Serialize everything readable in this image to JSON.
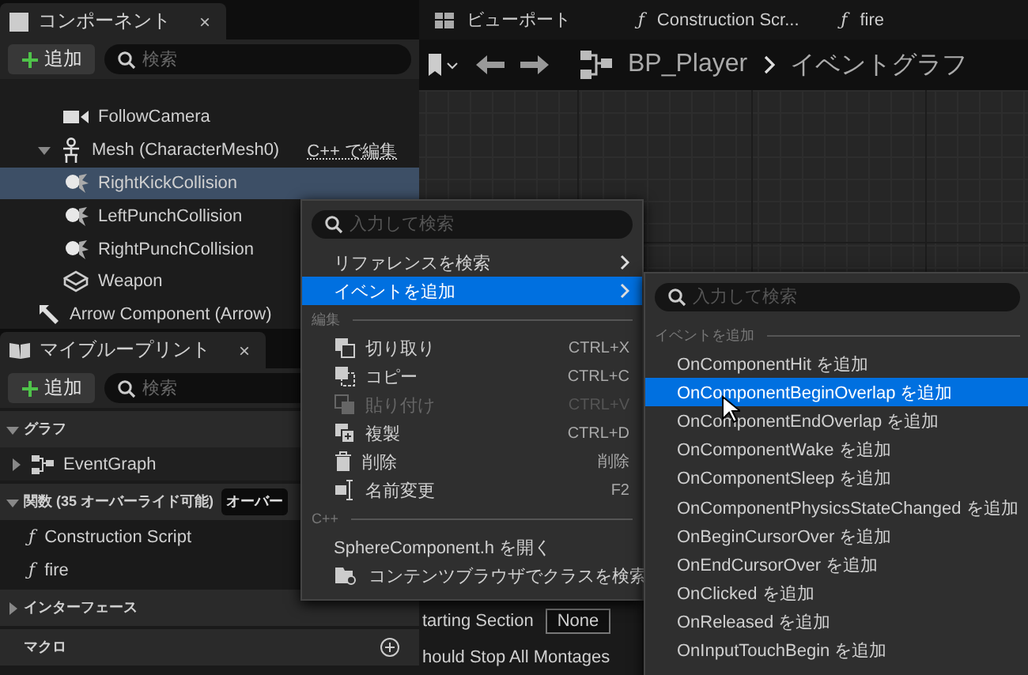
{
  "components_panel": {
    "tab": {
      "title": "コンポーネント",
      "close": "×"
    },
    "add_button": "追加",
    "search": {
      "placeholder": "検索"
    },
    "tree": [
      {
        "label": "FollowCamera",
        "kind": "camera",
        "selected": false
      },
      {
        "label": "Mesh (CharacterMesh0)",
        "kind": "mesh",
        "selected": false,
        "expanded": true,
        "action": "C++ で編集",
        "children": [
          {
            "label": "RightKickCollision",
            "kind": "collision",
            "selected": true
          },
          {
            "label": "LeftPunchCollision",
            "kind": "collision",
            "selected": false
          },
          {
            "label": "RightPunchCollision",
            "kind": "collision",
            "selected": false
          },
          {
            "label": "Weapon",
            "kind": "weapon",
            "selected": false
          }
        ]
      },
      {
        "label": "Arrow Component (Arrow)",
        "kind": "arrow",
        "selected": false
      }
    ]
  },
  "blueprint_panel": {
    "tab": {
      "title": "マイブループリント",
      "close": "×"
    },
    "add_button": "追加",
    "search": {
      "placeholder": "検索"
    },
    "sections": [
      {
        "title": "グラフ",
        "expanded": true,
        "items": [
          {
            "label": "EventGraph",
            "kind": "graph",
            "expanded": false
          }
        ]
      },
      {
        "title": "関数 (35 オーバーライド可能)",
        "button": "オーバー",
        "expanded": true,
        "items": [
          {
            "label": "Construction Script",
            "kind": "function",
            "glyph": "ƒ"
          },
          {
            "label": "fire",
            "kind": "function",
            "glyph": "ƒ"
          }
        ]
      },
      {
        "title": "インターフェース",
        "expanded": false
      },
      {
        "title": "マクロ",
        "add": true
      }
    ]
  },
  "editor_tabs": [
    {
      "label": "ビューポート",
      "kind": "viewport",
      "selected": false
    },
    {
      "label": "Construction Scr...",
      "kind": "function",
      "glyph": "ƒ",
      "selected": false
    },
    {
      "label": "fire",
      "kind": "function",
      "glyph": "ƒ",
      "selected": false
    }
  ],
  "breadcrumb": {
    "blueprint": "BP_Player",
    "graph": "イベントグラフ"
  },
  "details": [
    {
      "label": "tarting Section",
      "value": "None"
    },
    {
      "label": "hould Stop All Montages"
    }
  ],
  "context_menu": {
    "search": {
      "placeholder": "入力して検索"
    },
    "items": [
      {
        "kind": "plain",
        "label": "リファレンスを検索",
        "submenu": true,
        "selected": false,
        "disabled": false
      },
      {
        "kind": "plain",
        "label": "イベントを追加",
        "submenu": true,
        "selected": true,
        "disabled": false
      },
      {
        "kind": "header",
        "label": "編集"
      },
      {
        "kind": "cut",
        "label": "切り取り",
        "shortcut": "CTRL+X",
        "selected": false,
        "disabled": false
      },
      {
        "kind": "copy",
        "label": "コピー",
        "shortcut": "CTRL+C",
        "selected": false,
        "disabled": false
      },
      {
        "kind": "paste",
        "label": "貼り付け",
        "shortcut": "CTRL+V",
        "selected": false,
        "disabled": true
      },
      {
        "kind": "duplicate",
        "label": "複製",
        "shortcut": "CTRL+D",
        "selected": false,
        "disabled": false
      },
      {
        "kind": "delete",
        "label": "削除",
        "shortcut": "削除",
        "selected": false,
        "disabled": false
      },
      {
        "kind": "rename",
        "label": "名前変更",
        "shortcut": "F2",
        "selected": false,
        "disabled": false
      },
      {
        "kind": "header",
        "label": "C++"
      },
      {
        "kind": "plain",
        "label": "SphereComponent.h を開く",
        "submenu": false,
        "selected": false,
        "disabled": false
      },
      {
        "kind": "browse",
        "label": "コンテンツブラウザでクラスを検索",
        "selected": false,
        "disabled": false
      }
    ]
  },
  "submenu": {
    "search": {
      "placeholder": "入力して検索"
    },
    "header": "イベントを追加",
    "items": [
      {
        "label": "OnComponentHit を追加",
        "selected": false
      },
      {
        "label": "OnComponentBeginOverlap を追加",
        "selected": true
      },
      {
        "label": "OnComponentEndOverlap を追加",
        "selected": false
      },
      {
        "label": "OnComponentWake を追加",
        "selected": false
      },
      {
        "label": "OnComponentSleep を追加",
        "selected": false
      },
      {
        "label": "OnComponentPhysicsStateChanged を追加",
        "selected": false
      },
      {
        "label": "OnBeginCursorOver を追加",
        "selected": false
      },
      {
        "label": "OnEndCursorOver を追加",
        "selected": false
      },
      {
        "label": "OnClicked を追加",
        "selected": false
      },
      {
        "label": "OnReleased を追加",
        "selected": false
      },
      {
        "label": "OnInputTouchBegin を追加",
        "selected": false
      }
    ]
  }
}
